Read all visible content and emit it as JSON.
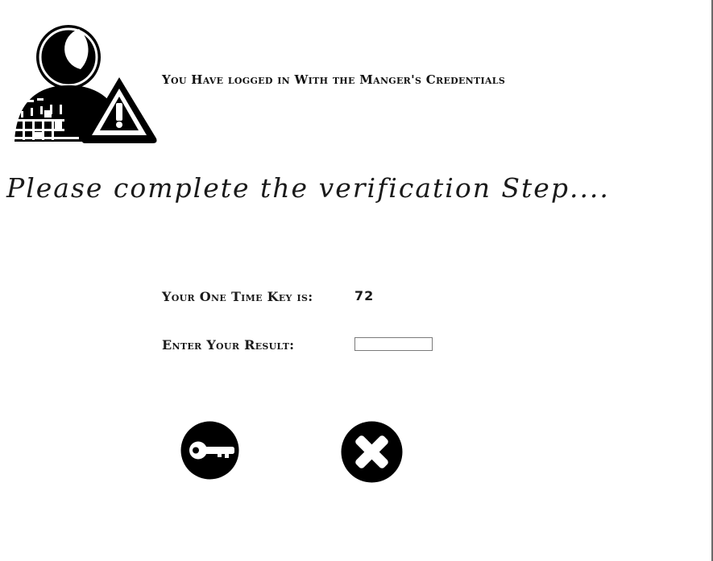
{
  "header": {
    "notice": "You Have logged in With the Manger's Credentials",
    "logo_icon": "user-warning-icon"
  },
  "main": {
    "headline": "Please complete the verification Step....",
    "one_time_key_label": "Your One Time Key is:",
    "one_time_key_value": "72",
    "result_label": "Enter Your Result:",
    "result_value": "",
    "result_placeholder": ""
  },
  "actions": {
    "submit_icon": "key-icon",
    "cancel_icon": "close-icon"
  },
  "colors": {
    "icon": "#000000",
    "background": "#ffffff",
    "text": "#1a1a1a"
  }
}
